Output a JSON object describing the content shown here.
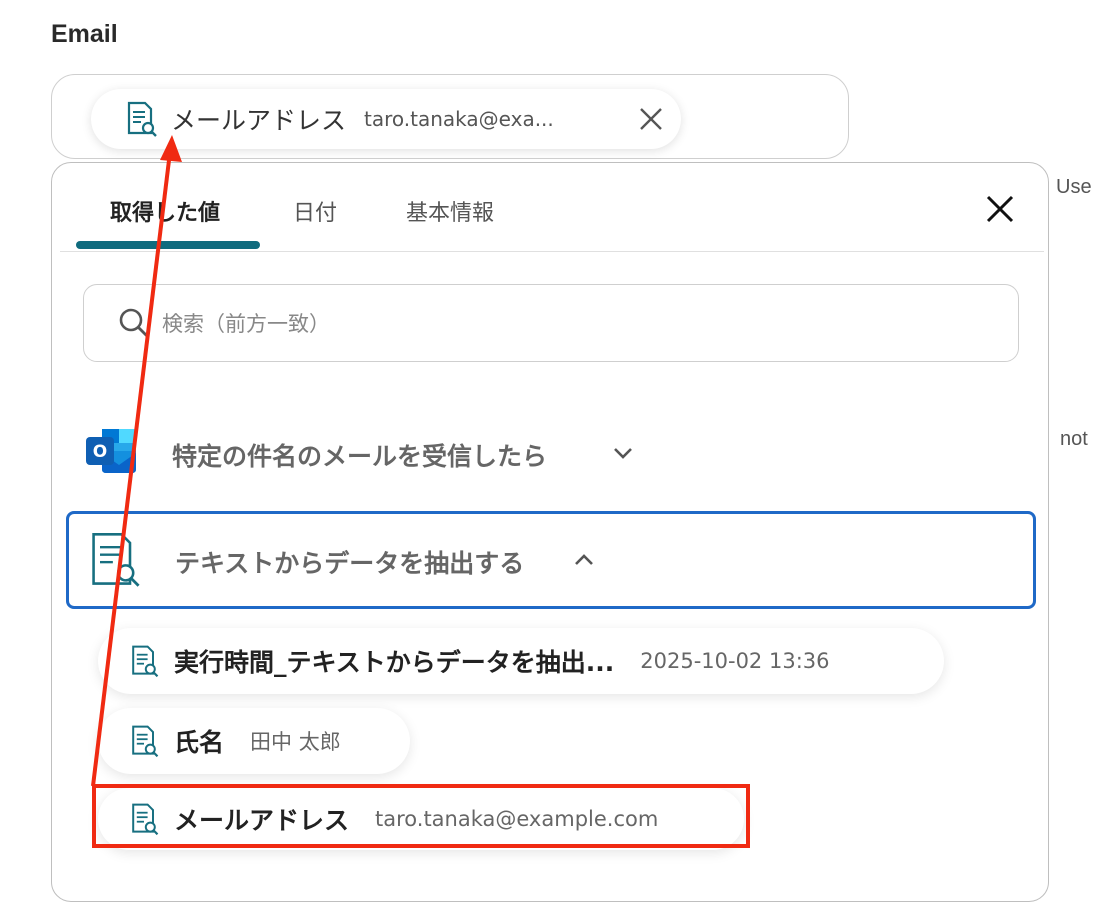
{
  "field": {
    "label": "Email"
  },
  "selected_chip": {
    "label": "メールアドレス",
    "value": "taro.tanaka@exa..."
  },
  "side_text": {
    "use": "Use",
    "not": "not"
  },
  "panel": {
    "tabs": [
      {
        "label": "取得した値"
      },
      {
        "label": "日付"
      },
      {
        "label": "基本情報"
      }
    ],
    "search": {
      "placeholder": "検索（前方一致）"
    },
    "sections": [
      {
        "title": "特定の件名のメールを受信したら",
        "expanded": false
      },
      {
        "title": "テキストからデータを抽出する",
        "expanded": true
      }
    ],
    "items": [
      {
        "label": "実行時間_テキストからデータを抽出...",
        "value": "2025-10-02 13:36"
      },
      {
        "label": "氏名",
        "value": "田中 太郎"
      },
      {
        "label": "メールアドレス",
        "value": "taro.tanaka@example.com"
      }
    ]
  },
  "colors": {
    "accent": "#0f6b7e",
    "selection_border": "#1f69c7",
    "annotation_red": "#f02a12",
    "outlook_blue": "#0a64c9"
  }
}
